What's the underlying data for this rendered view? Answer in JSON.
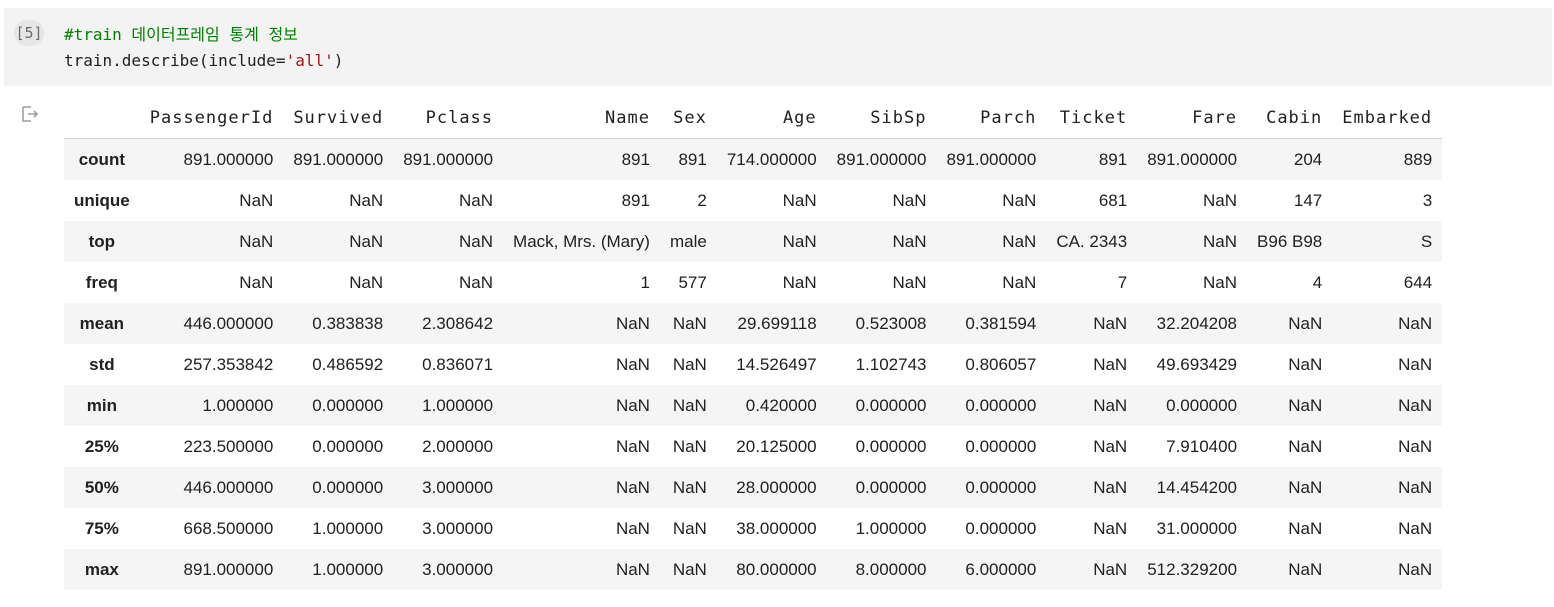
{
  "cell": {
    "execution_count": "[5]",
    "code_line1_comment": "#train 데이터프레임 통계 정보",
    "code_line2_prefix": "train.describe(include=",
    "code_line2_string": "'all'",
    "code_line2_suffix": ")"
  },
  "output": {
    "icon": "output-arrow-icon",
    "table": {
      "columns": [
        "",
        "PassengerId",
        "Survived",
        "Pclass",
        "Name",
        "Sex",
        "Age",
        "SibSp",
        "Parch",
        "Ticket",
        "Fare",
        "Cabin",
        "Embarked"
      ],
      "rows": [
        {
          "index": "count",
          "cells": [
            "891.000000",
            "891.000000",
            "891.000000",
            "891",
            "891",
            "714.000000",
            "891.000000",
            "891.000000",
            "891",
            "891.000000",
            "204",
            "889"
          ]
        },
        {
          "index": "unique",
          "cells": [
            "NaN",
            "NaN",
            "NaN",
            "891",
            "2",
            "NaN",
            "NaN",
            "NaN",
            "681",
            "NaN",
            "147",
            "3"
          ]
        },
        {
          "index": "top",
          "cells": [
            "NaN",
            "NaN",
            "NaN",
            "Mack, Mrs. (Mary)",
            "male",
            "NaN",
            "NaN",
            "NaN",
            "CA. 2343",
            "NaN",
            "B96 B98",
            "S"
          ]
        },
        {
          "index": "freq",
          "cells": [
            "NaN",
            "NaN",
            "NaN",
            "1",
            "577",
            "NaN",
            "NaN",
            "NaN",
            "7",
            "NaN",
            "4",
            "644"
          ]
        },
        {
          "index": "mean",
          "cells": [
            "446.000000",
            "0.383838",
            "2.308642",
            "NaN",
            "NaN",
            "29.699118",
            "0.523008",
            "0.381594",
            "NaN",
            "32.204208",
            "NaN",
            "NaN"
          ]
        },
        {
          "index": "std",
          "cells": [
            "257.353842",
            "0.486592",
            "0.836071",
            "NaN",
            "NaN",
            "14.526497",
            "1.102743",
            "0.806057",
            "NaN",
            "49.693429",
            "NaN",
            "NaN"
          ]
        },
        {
          "index": "min",
          "cells": [
            "1.000000",
            "0.000000",
            "1.000000",
            "NaN",
            "NaN",
            "0.420000",
            "0.000000",
            "0.000000",
            "NaN",
            "0.000000",
            "NaN",
            "NaN"
          ]
        },
        {
          "index": "25%",
          "cells": [
            "223.500000",
            "0.000000",
            "2.000000",
            "NaN",
            "NaN",
            "20.125000",
            "0.000000",
            "0.000000",
            "NaN",
            "7.910400",
            "NaN",
            "NaN"
          ]
        },
        {
          "index": "50%",
          "cells": [
            "446.000000",
            "0.000000",
            "3.000000",
            "NaN",
            "NaN",
            "28.000000",
            "0.000000",
            "0.000000",
            "NaN",
            "14.454200",
            "NaN",
            "NaN"
          ]
        },
        {
          "index": "75%",
          "cells": [
            "668.500000",
            "1.000000",
            "3.000000",
            "NaN",
            "NaN",
            "38.000000",
            "1.000000",
            "0.000000",
            "NaN",
            "31.000000",
            "NaN",
            "NaN"
          ]
        },
        {
          "index": "max",
          "cells": [
            "891.000000",
            "1.000000",
            "3.000000",
            "NaN",
            "NaN",
            "80.000000",
            "8.000000",
            "6.000000",
            "NaN",
            "512.329200",
            "NaN",
            "NaN"
          ]
        }
      ]
    }
  }
}
